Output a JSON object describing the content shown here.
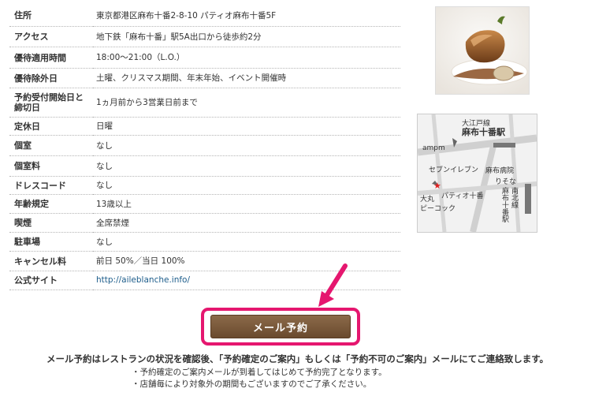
{
  "details": [
    {
      "label": "住所",
      "value": "東京都港区麻布十番2-8-10 パティオ麻布十番5F"
    },
    {
      "label": "アクセス",
      "value": "地下鉄「麻布十番」駅5A出口から徒歩約2分"
    },
    {
      "label": "優待適用時間",
      "value": "18:00〜21:00（L.O.）"
    },
    {
      "label": "優待除外日",
      "value": "土曜、クリスマス期間、年末年始、イベント開催時"
    },
    {
      "label": "予約受付開始日と締切日",
      "value": "1ヵ月前から3営業日前まで"
    },
    {
      "label": "定休日",
      "value": "日曜"
    },
    {
      "label": "個室",
      "value": "なし"
    },
    {
      "label": "個室料",
      "value": "なし"
    },
    {
      "label": "ドレスコード",
      "value": "なし"
    },
    {
      "label": "年齢規定",
      "value": "13歳以上"
    },
    {
      "label": "喫煙",
      "value": "全席禁煙"
    },
    {
      "label": "駐車場",
      "value": "なし"
    },
    {
      "label": "キャンセル料",
      "value": "前日 50%／当日 100%"
    },
    {
      "label": "公式サイト",
      "value": "http://aileblanche.info/"
    }
  ],
  "map": {
    "line_label": "大江戸線",
    "station_label": "麻布十番駅",
    "ampm": "ampm",
    "seven": "セブンイレブン",
    "hospital": "麻布病院",
    "bank": "りそな",
    "patio": "パティオ十番",
    "daimaru": "大丸",
    "peacock": "ピーコック",
    "namboku_station": "麻布十番駅",
    "namboku_line": "南北線"
  },
  "reserve_button": "メール予約",
  "notice": "メール予約はレストランの状況を確認後、「予約確定のご案内」もしくは「予約不可のご案内」メールにてご連絡致します。",
  "notes": [
    "・予約確定のご案内メールが到着してはじめて予約完了となります。",
    "・店舗毎により対象外の期間もございますのでご了承ください。"
  ],
  "colors": {
    "highlight": "#e5176f",
    "button": "#7a5a3c",
    "link": "#1d5d8b"
  }
}
